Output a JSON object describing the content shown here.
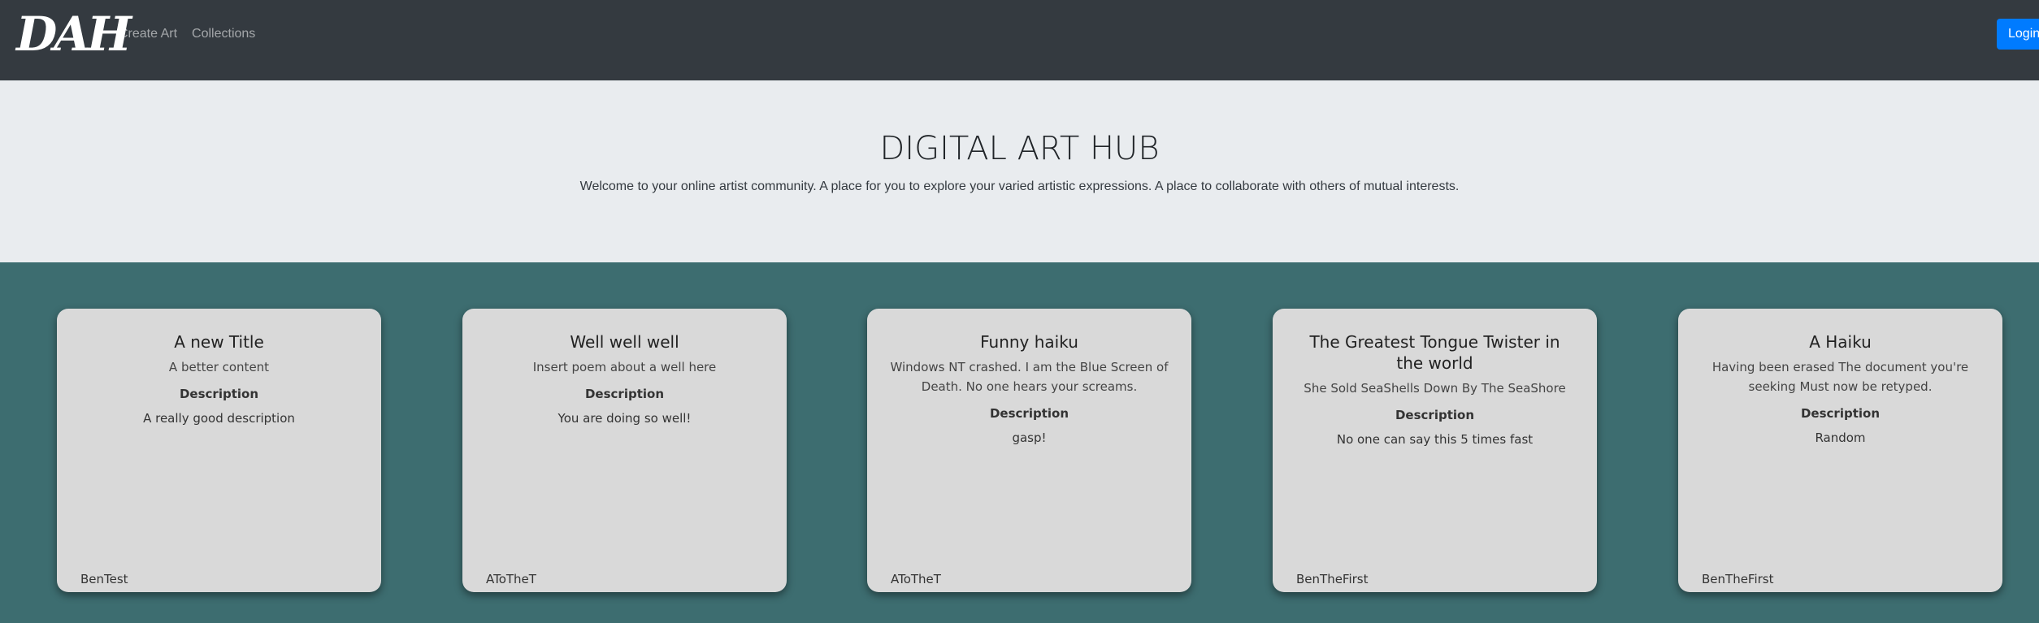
{
  "nav": {
    "brand": "DAH",
    "links": [
      "Create Art",
      "Collections"
    ],
    "login_label": "Login"
  },
  "hero": {
    "title": "DIGITAL ART HUB",
    "subtitle": "Welcome to your online artist community. A place for you to explore your varied artistic expressions. A place to collaborate with others of mutual interests."
  },
  "cards": [
    {
      "title": "A new Title",
      "content": "A better content",
      "description_label": "Description",
      "description": "A really good description",
      "author": "BenTest"
    },
    {
      "title": "Well well well",
      "content": "Insert poem about a well here",
      "description_label": "Description",
      "description": "You are doing so well!",
      "author": "AToTheT"
    },
    {
      "title": "Funny haiku",
      "content": "Windows NT crashed. I am the Blue Screen of Death. No one hears your screams.",
      "description_label": "Description",
      "description": "gasp!",
      "author": "AToTheT"
    },
    {
      "title": "The Greatest Tongue Twister in the world",
      "content": "She Sold SeaShells Down By The SeaShore",
      "description_label": "Description",
      "description": "No one can say this 5 times fast",
      "author": "BenTheFirst"
    },
    {
      "title": "A Haiku",
      "content": "Having been erased The document you're seeking Must now be retyped.",
      "description_label": "Description",
      "description": "Random",
      "author": "BenTheFirst"
    }
  ],
  "colors": {
    "navbar": "#343a40",
    "hero": "#e9ecef",
    "section": "#3d6d70",
    "card": "#d9d9d9",
    "login_button": "#007bff"
  }
}
